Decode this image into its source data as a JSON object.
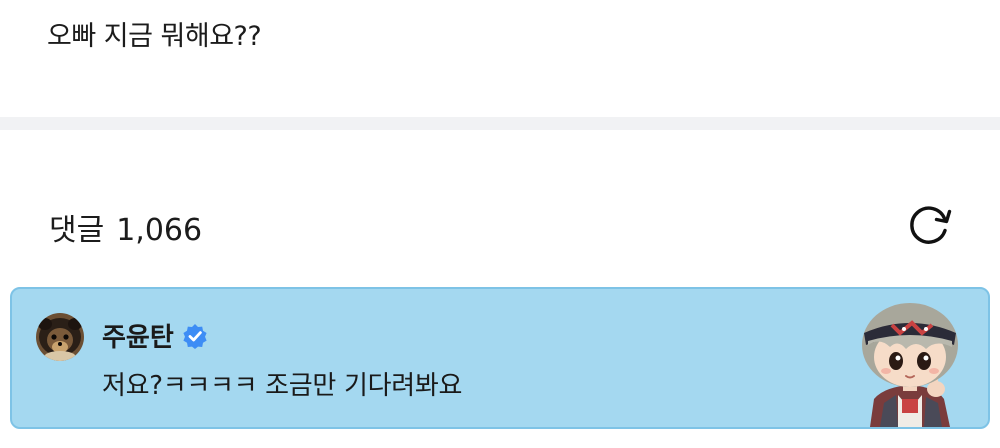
{
  "post": {
    "text": "오빠 지금 뭐해요??"
  },
  "comments": {
    "label": "댓글",
    "count": "1,066"
  },
  "icons": {
    "refresh": "refresh-icon",
    "verified": "verified-badge-icon"
  },
  "comment": {
    "author": "주윤탄",
    "text": "저요?ㅋㅋㅋㅋ 조금만 기다려봐요"
  },
  "colors": {
    "card_background": "#a4d8f0",
    "card_border": "#7ec3e6",
    "verified_badge": "#3d8df5",
    "divider": "#f1f2f4"
  }
}
